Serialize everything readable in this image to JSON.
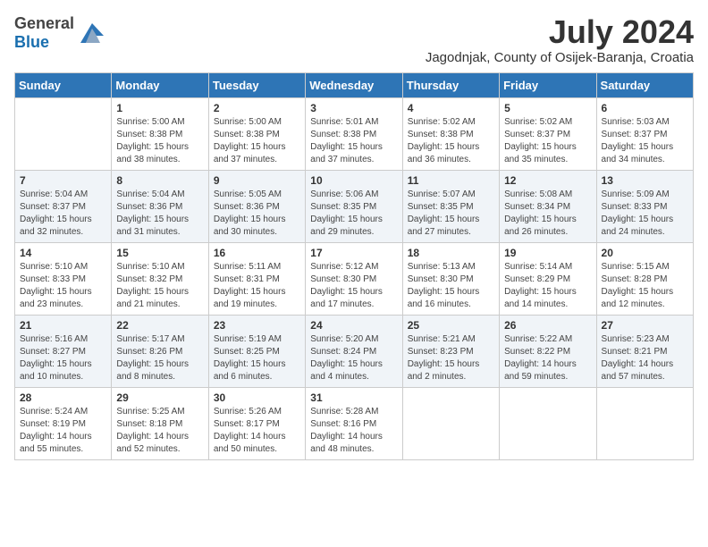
{
  "header": {
    "logo_line1": "General",
    "logo_line2": "Blue",
    "month_year": "July 2024",
    "location": "Jagodnjak, County of Osijek-Baranja, Croatia"
  },
  "weekdays": [
    "Sunday",
    "Monday",
    "Tuesday",
    "Wednesday",
    "Thursday",
    "Friday",
    "Saturday"
  ],
  "weeks": [
    [
      {
        "day": null,
        "text": null
      },
      {
        "day": "1",
        "text": "Sunrise: 5:00 AM\nSunset: 8:38 PM\nDaylight: 15 hours\nand 38 minutes."
      },
      {
        "day": "2",
        "text": "Sunrise: 5:00 AM\nSunset: 8:38 PM\nDaylight: 15 hours\nand 37 minutes."
      },
      {
        "day": "3",
        "text": "Sunrise: 5:01 AM\nSunset: 8:38 PM\nDaylight: 15 hours\nand 37 minutes."
      },
      {
        "day": "4",
        "text": "Sunrise: 5:02 AM\nSunset: 8:38 PM\nDaylight: 15 hours\nand 36 minutes."
      },
      {
        "day": "5",
        "text": "Sunrise: 5:02 AM\nSunset: 8:37 PM\nDaylight: 15 hours\nand 35 minutes."
      },
      {
        "day": "6",
        "text": "Sunrise: 5:03 AM\nSunset: 8:37 PM\nDaylight: 15 hours\nand 34 minutes."
      }
    ],
    [
      {
        "day": "7",
        "text": "Sunrise: 5:04 AM\nSunset: 8:37 PM\nDaylight: 15 hours\nand 32 minutes."
      },
      {
        "day": "8",
        "text": "Sunrise: 5:04 AM\nSunset: 8:36 PM\nDaylight: 15 hours\nand 31 minutes."
      },
      {
        "day": "9",
        "text": "Sunrise: 5:05 AM\nSunset: 8:36 PM\nDaylight: 15 hours\nand 30 minutes."
      },
      {
        "day": "10",
        "text": "Sunrise: 5:06 AM\nSunset: 8:35 PM\nDaylight: 15 hours\nand 29 minutes."
      },
      {
        "day": "11",
        "text": "Sunrise: 5:07 AM\nSunset: 8:35 PM\nDaylight: 15 hours\nand 27 minutes."
      },
      {
        "day": "12",
        "text": "Sunrise: 5:08 AM\nSunset: 8:34 PM\nDaylight: 15 hours\nand 26 minutes."
      },
      {
        "day": "13",
        "text": "Sunrise: 5:09 AM\nSunset: 8:33 PM\nDaylight: 15 hours\nand 24 minutes."
      }
    ],
    [
      {
        "day": "14",
        "text": "Sunrise: 5:10 AM\nSunset: 8:33 PM\nDaylight: 15 hours\nand 23 minutes."
      },
      {
        "day": "15",
        "text": "Sunrise: 5:10 AM\nSunset: 8:32 PM\nDaylight: 15 hours\nand 21 minutes."
      },
      {
        "day": "16",
        "text": "Sunrise: 5:11 AM\nSunset: 8:31 PM\nDaylight: 15 hours\nand 19 minutes."
      },
      {
        "day": "17",
        "text": "Sunrise: 5:12 AM\nSunset: 8:30 PM\nDaylight: 15 hours\nand 17 minutes."
      },
      {
        "day": "18",
        "text": "Sunrise: 5:13 AM\nSunset: 8:30 PM\nDaylight: 15 hours\nand 16 minutes."
      },
      {
        "day": "19",
        "text": "Sunrise: 5:14 AM\nSunset: 8:29 PM\nDaylight: 15 hours\nand 14 minutes."
      },
      {
        "day": "20",
        "text": "Sunrise: 5:15 AM\nSunset: 8:28 PM\nDaylight: 15 hours\nand 12 minutes."
      }
    ],
    [
      {
        "day": "21",
        "text": "Sunrise: 5:16 AM\nSunset: 8:27 PM\nDaylight: 15 hours\nand 10 minutes."
      },
      {
        "day": "22",
        "text": "Sunrise: 5:17 AM\nSunset: 8:26 PM\nDaylight: 15 hours\nand 8 minutes."
      },
      {
        "day": "23",
        "text": "Sunrise: 5:19 AM\nSunset: 8:25 PM\nDaylight: 15 hours\nand 6 minutes."
      },
      {
        "day": "24",
        "text": "Sunrise: 5:20 AM\nSunset: 8:24 PM\nDaylight: 15 hours\nand 4 minutes."
      },
      {
        "day": "25",
        "text": "Sunrise: 5:21 AM\nSunset: 8:23 PM\nDaylight: 15 hours\nand 2 minutes."
      },
      {
        "day": "26",
        "text": "Sunrise: 5:22 AM\nSunset: 8:22 PM\nDaylight: 14 hours\nand 59 minutes."
      },
      {
        "day": "27",
        "text": "Sunrise: 5:23 AM\nSunset: 8:21 PM\nDaylight: 14 hours\nand 57 minutes."
      }
    ],
    [
      {
        "day": "28",
        "text": "Sunrise: 5:24 AM\nSunset: 8:19 PM\nDaylight: 14 hours\nand 55 minutes."
      },
      {
        "day": "29",
        "text": "Sunrise: 5:25 AM\nSunset: 8:18 PM\nDaylight: 14 hours\nand 52 minutes."
      },
      {
        "day": "30",
        "text": "Sunrise: 5:26 AM\nSunset: 8:17 PM\nDaylight: 14 hours\nand 50 minutes."
      },
      {
        "day": "31",
        "text": "Sunrise: 5:28 AM\nSunset: 8:16 PM\nDaylight: 14 hours\nand 48 minutes."
      },
      {
        "day": null,
        "text": null
      },
      {
        "day": null,
        "text": null
      },
      {
        "day": null,
        "text": null
      }
    ]
  ]
}
